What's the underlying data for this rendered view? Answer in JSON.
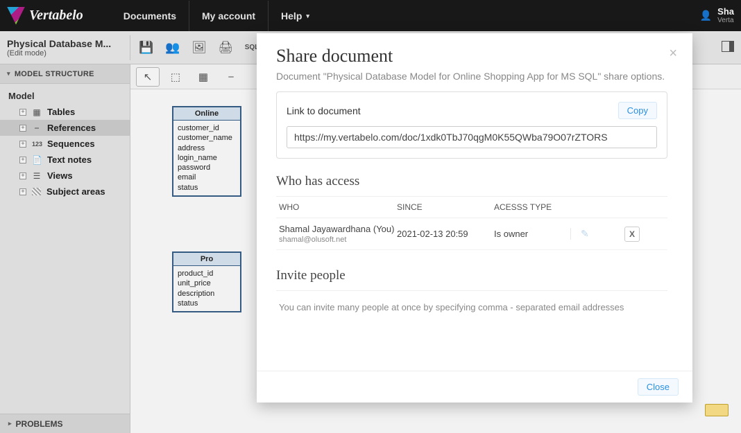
{
  "brand": "Vertabelo",
  "topnav": {
    "documents": "Documents",
    "account": "My account",
    "help": "Help"
  },
  "user": {
    "name": "Sha",
    "company": "Verta"
  },
  "doc": {
    "title": "Physical Database M...",
    "mode": "(Edit mode)"
  },
  "sidebar": {
    "heading": "MODEL STRUCTURE",
    "root": "Model",
    "items": [
      {
        "label": "Tables"
      },
      {
        "label": "References"
      },
      {
        "label": "Sequences"
      },
      {
        "label": "Text notes"
      },
      {
        "label": "Views"
      },
      {
        "label": "Subject areas"
      }
    ],
    "problems": "PROBLEMS"
  },
  "tables": {
    "customer": {
      "title": "Online",
      "cols": [
        "customer_id",
        "customer_name",
        "address",
        "login_name",
        "password",
        "email",
        "status"
      ]
    },
    "product": {
      "title": "Pro",
      "cols": [
        "product_id",
        "unit_price",
        "description",
        "status"
      ]
    }
  },
  "modal": {
    "title": "Share document",
    "subtitle": "Document \"Physical Database Model for Online Shopping App for MS SQL\" share options.",
    "link_label": "Link to document",
    "copy": "Copy",
    "link_value": "https://my.vertabelo.com/doc/1xdk0TbJ70qgM0K55QWba79O07rZTORS",
    "access_title": "Who has access",
    "col_who": "WHO",
    "col_since": "SINCE",
    "col_type": "ACESSS TYPE",
    "rows": [
      {
        "name": "Shamal Jayawardhana (You)",
        "email": "shamal@olusoft.net",
        "since": "2021-02-13 20:59",
        "type": "Is owner"
      }
    ],
    "invite_title": "Invite people",
    "invite_hint": "You can invite many people at once by specifying comma - separated email addresses",
    "close": "Close",
    "remove": "X"
  }
}
